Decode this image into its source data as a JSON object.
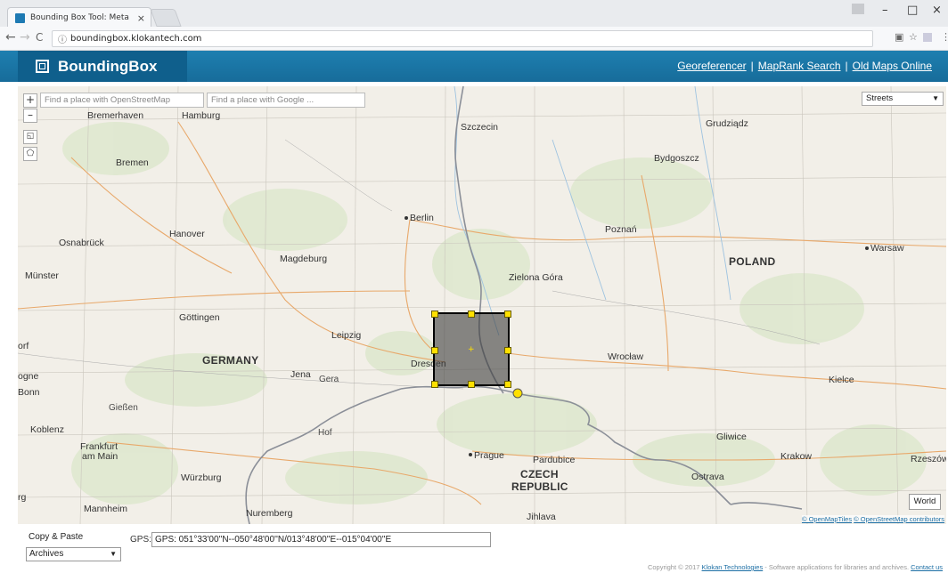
{
  "browser": {
    "tab_title": "Bounding Box Tool: Meta",
    "tab_close": "×",
    "url": "boundingbox.klokantech.com",
    "info_icon": "ⓘ",
    "back": "←",
    "forward": "→",
    "reload": "C",
    "minimize": "–",
    "maximize": "□",
    "close": "×"
  },
  "header": {
    "logo_text": "BoundingBox",
    "links": [
      "Georeferencer",
      "MapRank Search",
      "Old Maps Online"
    ],
    "separator": "|",
    "color": "#1a75a6"
  },
  "map": {
    "zoom_in": "+",
    "zoom_out": "–",
    "search_osm_placeholder": "Find a place with OpenStreetMap",
    "search_google_placeholder": "Find a place with Google ...",
    "layer": "Streets",
    "world_button": "World",
    "attribution": {
      "a": "© OpenMapTiles",
      "b": "© OpenStreetMap contributors"
    },
    "labels": {
      "bremerhaven": "Bremerhaven",
      "hamburg": "Hamburg",
      "szczecin": "Szczecin",
      "grudziadz": "Grudziądz",
      "bremen": "Bremen",
      "bydgoszcz": "Bydgoszcz",
      "berlin": "Berlin",
      "osnabruck": "Osnabrück",
      "hanover": "Hanover",
      "poznan": "Poznań",
      "warsaw": "Warsaw",
      "magdeburg": "Magdeburg",
      "poland": "POLAND",
      "munster": "Münster",
      "zielona_gora": "Zielona Góra",
      "gottingen": "Göttingen",
      "orf": "orf",
      "leipzig": "Leipzig",
      "germany": "GERMANY",
      "dresden": "Dresden",
      "wroclaw": "Wrocław",
      "ogne": "ogne",
      "jena": "Jena",
      "gera": "Gera",
      "bonn": "Bonn",
      "kielce": "Kielce",
      "giessen": "Gießen",
      "koblenz": "Koblenz",
      "hof": "Hof",
      "gliwice": "Gliwice",
      "frankfurt": "Frankfurt",
      "am_main": "am Main",
      "prague": "Prague",
      "pardubice": "Pardubice",
      "krakow": "Krakow",
      "rzeszow": "Rzeszów",
      "czech": "CZECH",
      "republic": "REPUBLIC",
      "wurzburg": "Würzburg",
      "ostrava": "Ostrava",
      "rg": "rg",
      "mannheim": "Mannheim",
      "nuremberg": "Nuremberg",
      "jihlava": "Jihlava"
    }
  },
  "bottom": {
    "copy_paste_label": "Copy & Paste",
    "format_value": "Archives",
    "gps_label": "GPS:",
    "gps_value": "GPS: 051°33'00''N--050°48'00''N/013°48'00''E--015°04'00''E",
    "footer_prefix": "Copyright © 2017",
    "footer_company": "Klokan Technologies",
    "footer_suffix": "- Software applications for libraries and archives.",
    "footer_contact": "Contact us"
  }
}
